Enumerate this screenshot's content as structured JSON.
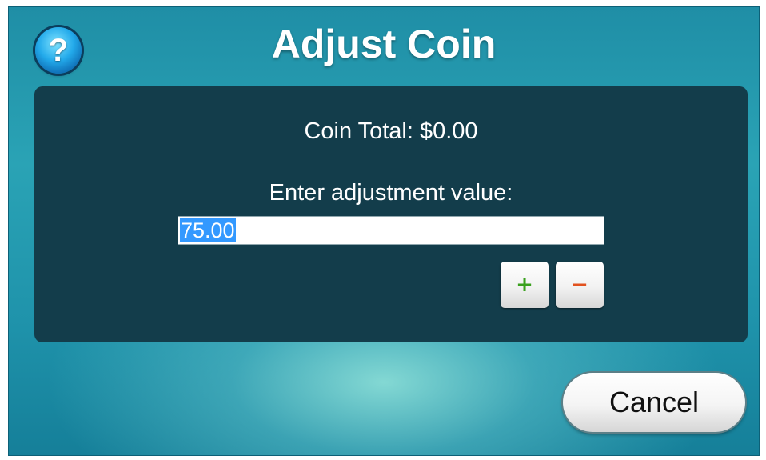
{
  "dialog": {
    "title": "Adjust Coin",
    "help_glyph": "?"
  },
  "panel": {
    "coin_total": "Coin Total: $0.00",
    "prompt": "Enter adjustment value:",
    "input_value": "75.00",
    "plus_glyph": "+",
    "minus_glyph": "−"
  },
  "footer": {
    "cancel_label": "Cancel"
  },
  "colors": {
    "panel_bg": "#133d4b",
    "background_teal": "#1f8ea6",
    "selection": "#3399ff",
    "plus": "#3aa11e",
    "minus": "#e2521f"
  },
  "icons": {
    "help": "help-question-icon",
    "plus": "plus-icon",
    "minus": "minus-icon"
  }
}
